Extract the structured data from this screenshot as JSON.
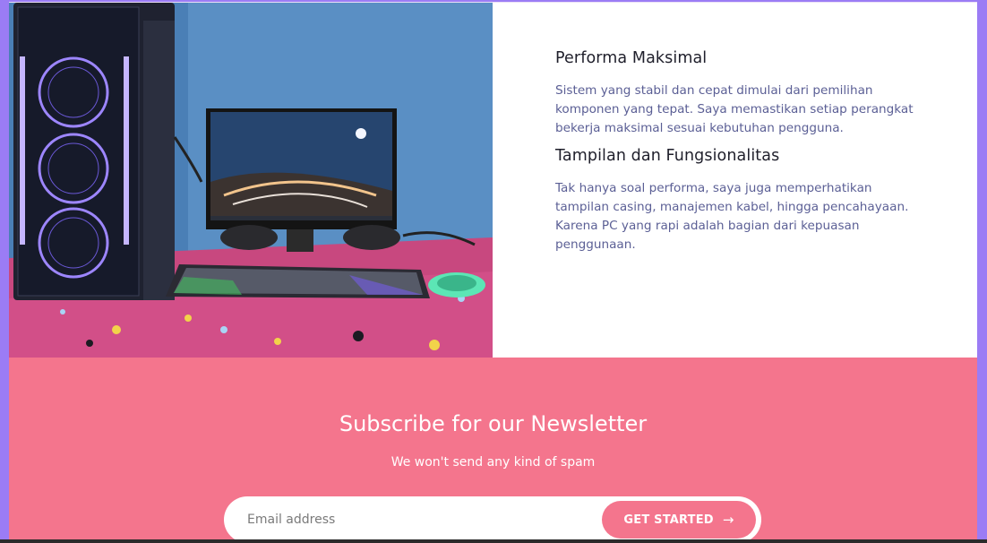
{
  "features": [
    {
      "title": "Performa Maksimal",
      "text": "Sistem yang stabil dan cepat dimulai dari pemilihan komponen yang tepat. Saya memastikan setiap perangkat bekerja maksimal sesuai kebutuhan pengguna."
    },
    {
      "title": "Tampilan dan Fungsionalitas",
      "text": "Tak hanya soal performa, saya juga memperhatikan tampilan casing, manajemen kabel, hingga pencahayaan. Karena PC yang rapi adalah bagian dari kepuasan penggunaan."
    }
  ],
  "newsletter": {
    "title": "Subscribe for our Newsletter",
    "subtitle": "We won't send any kind of spam",
    "email_placeholder": "Email address",
    "button_label": "GET STARTED",
    "button_icon": "arrow-right-icon"
  },
  "colors": {
    "accent_pink": "#f4758d",
    "text_heading": "#1f1f2b",
    "text_body": "#5b5f95",
    "frame_purple": "#9b7cf5"
  }
}
